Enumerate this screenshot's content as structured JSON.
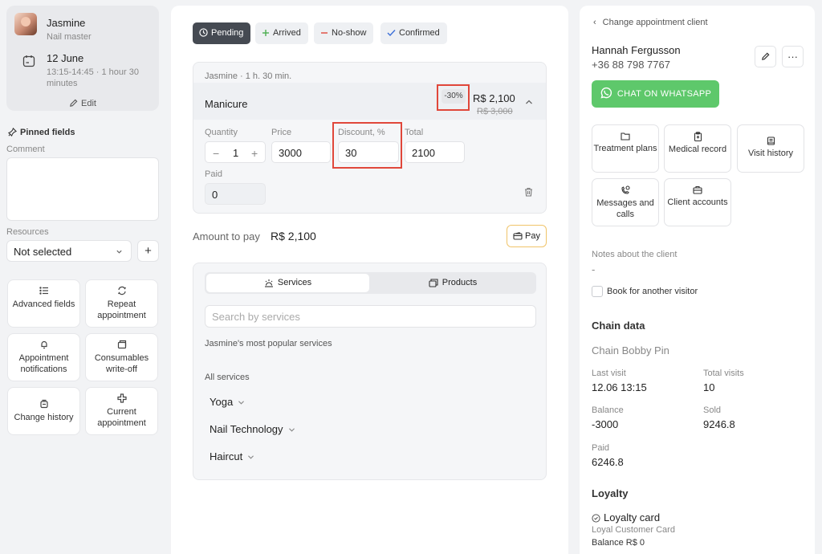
{
  "master": {
    "name": "Jasmine",
    "role": "Nail master",
    "date": "12 June",
    "time": "13:15-14:45 · 1 hour 30 minutes",
    "edit_label": "Edit"
  },
  "left_panel": {
    "pinned_title": "Pinned fields",
    "comment_label": "Comment",
    "resources_label": "Resources",
    "resources_value": "Not selected",
    "tiles": [
      {
        "label": "Advanced fields",
        "icon": "list-icon"
      },
      {
        "label": "Repeat appointment",
        "icon": "repeat-icon"
      },
      {
        "label": "Appointment notifications",
        "icon": "bell-icon"
      },
      {
        "label": "Consumables write-off",
        "icon": "box-icon"
      },
      {
        "label": "Change history",
        "icon": "history-icon"
      },
      {
        "label": "Current appointment",
        "icon": "plus-cross-icon"
      }
    ]
  },
  "statuses": [
    {
      "label": "Pending",
      "icon": "clock-icon",
      "active": true
    },
    {
      "label": "Arrived",
      "icon": "plus-icon",
      "color": "#4caf50"
    },
    {
      "label": "No-show",
      "icon": "minus-icon",
      "color": "#e0473a"
    },
    {
      "label": "Confirmed",
      "icon": "check-icon",
      "color": "#3b6fd8"
    }
  ],
  "service": {
    "meta": "Jasmine · 1 h. 30 min.",
    "name": "Manicure",
    "discount_badge": "-30%",
    "price_new": "R$ 2,100",
    "price_old": "R$ 3,000",
    "quantity_label": "Quantity",
    "quantity": "1",
    "price_label": "Price",
    "price": "3000",
    "discount_label": "Discount, %",
    "discount": "30",
    "total_label": "Total",
    "total": "2100",
    "paid_label": "Paid",
    "paid": "0"
  },
  "payment": {
    "amount_label": "Amount to pay",
    "amount_value": "R$ 2,100",
    "pay_label": "Pay"
  },
  "catalog": {
    "tab_services": "Services",
    "tab_products": "Products",
    "search_placeholder": "Search by services",
    "popular_label": "Jasmine's most popular services",
    "all_label": "All services",
    "categories": [
      "Yoga",
      "Nail Technology",
      "Haircut"
    ]
  },
  "client": {
    "back_label": "Change appointment client",
    "name": "Hannah Fergusson",
    "phone": "+36 88 798 7767",
    "whatsapp_label": "CHAT ON WHATSAPP",
    "tiles": [
      {
        "label": "Treatment plans",
        "icon": "folder-icon"
      },
      {
        "label": "Medical record",
        "icon": "clipboard-icon"
      },
      {
        "label": "Visit history",
        "icon": "history-book-icon"
      },
      {
        "label": "Messages and calls",
        "icon": "phone-chat-icon"
      },
      {
        "label": "Client accounts",
        "icon": "briefcase-icon"
      }
    ],
    "notes_label": "Notes about the client",
    "notes_value": "-",
    "book_other_label": "Book for another visitor"
  },
  "chain": {
    "title": "Chain data",
    "name": "Chain Bobby Pin",
    "last_visit_label": "Last visit",
    "last_visit": "12.06 13:15",
    "total_visits_label": "Total visits",
    "total_visits": "10",
    "balance_label": "Balance",
    "balance": "-3000",
    "sold_label": "Sold",
    "sold": "9246.8",
    "paid_label": "Paid",
    "paid": "6246.8"
  },
  "loyalty": {
    "title": "Loyalty",
    "card_label": "Loyalty card",
    "card_name": "Loyal Customer Card",
    "balance": "Balance R$ 0"
  },
  "colors": {
    "highlight": "#e0473a",
    "whatsapp": "#5ec86b",
    "active_status": "#454a52",
    "pay_border": "#f0c46a"
  }
}
